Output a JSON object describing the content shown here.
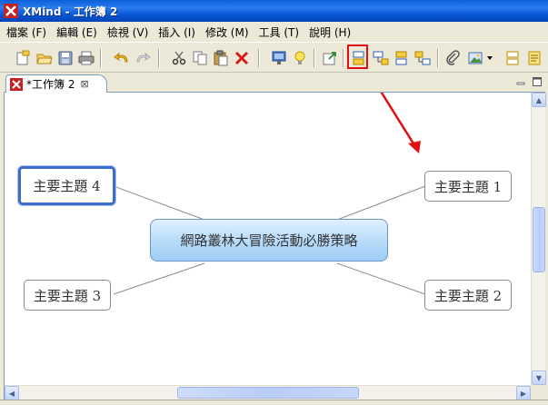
{
  "window": {
    "title": "XMind - 工作簿 2"
  },
  "menu": [
    "檔案 (F)",
    "編輯 (E)",
    "檢視 (V)",
    "插入 (I)",
    "修改 (M)",
    "工具 (T)",
    "說明 (H)"
  ],
  "toolbar": {
    "buttons": [
      "new-workbook-icon",
      "open-folder-icon",
      "save-icon",
      "print-icon",
      "undo-icon",
      "redo-icon",
      "cut-icon",
      "copy-icon",
      "paste-icon",
      "delete-icon",
      "presentation-icon",
      "idea-icon",
      "export-icon",
      "insert-topic-icon",
      "insert-subtopic-icon",
      "insert-topic-before-icon",
      "insert-parent-topic-icon",
      "attachment-icon",
      "insert-image-icon",
      "image-dropdown-icon",
      "boundary-icon",
      "notes-icon"
    ],
    "highlighted": "insert-topic-icon"
  },
  "tab": {
    "label": "*工作簿 2",
    "close": "⊠"
  },
  "map": {
    "central": "網路叢林大冒險活動必勝策略",
    "topics": [
      "主要主題 1",
      "主要主題 2",
      "主要主題 3",
      "主要主題 4"
    ],
    "selected_topic": "主要主題 4"
  },
  "colors": {
    "titlebar": "#0a5fd8",
    "annotation": "#e01010",
    "central_fill": "#b9dcfa",
    "selection": "#3d6dc9"
  }
}
